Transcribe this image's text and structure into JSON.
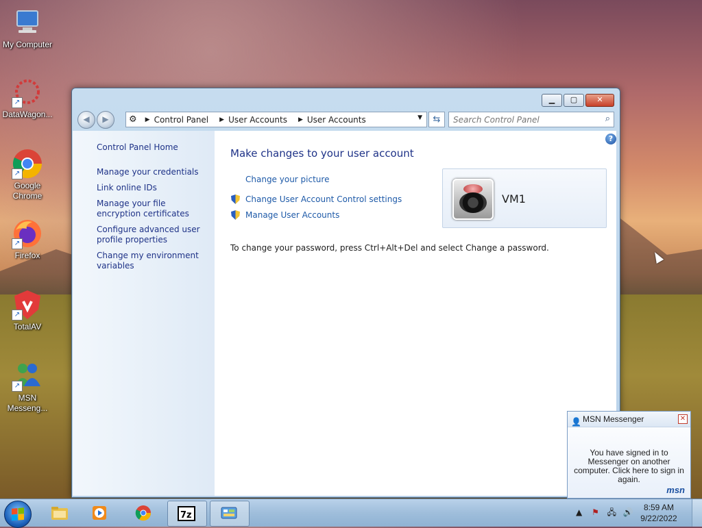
{
  "desktop": {
    "icons": [
      {
        "label": "My Computer"
      },
      {
        "label": "DataWagon..."
      },
      {
        "label": "Google Chrome"
      },
      {
        "label": "Firefox"
      },
      {
        "label": "TotalAV"
      },
      {
        "label": "MSN Messeng..."
      }
    ]
  },
  "window": {
    "breadcrumb": [
      "Control Panel",
      "User Accounts",
      "User Accounts"
    ],
    "search_placeholder": "Search Control Panel",
    "left_pane": [
      "Control Panel Home",
      "Manage your credentials",
      "Link online IDs",
      "Manage your file encryption certificates",
      "Configure advanced user profile properties",
      "Change my environment variables"
    ],
    "title": "Make changes to your user account",
    "links": {
      "change_picture": "Change your picture",
      "uac_settings": "Change User Account Control settings",
      "manage_accounts": "Manage User Accounts"
    },
    "account_name": "VM1",
    "password_note": "To change your password, press Ctrl+Alt+Del and select Change a password."
  },
  "msn_popup": {
    "title": "MSN Messenger",
    "message": "You have signed in to Messenger on another computer. Click here to sign in again.",
    "logo": "msn"
  },
  "taskbar": {
    "time": "8:59 AM",
    "date": "9/22/2022"
  },
  "colors": {
    "link": "#1e5aa8",
    "heading": "#1e3287"
  }
}
